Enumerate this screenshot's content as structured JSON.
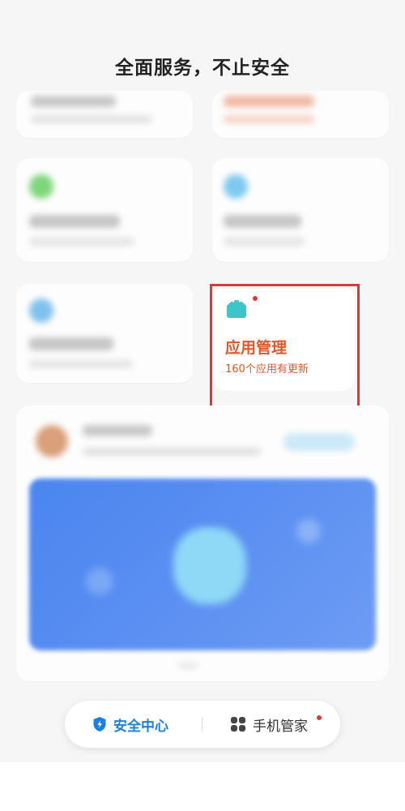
{
  "headline": "全面服务，不止安全",
  "app_card": {
    "title": "应用管理",
    "subtitle": "160个应用有更新",
    "icon": "android-icon",
    "has_badge": true
  },
  "bottom_nav": {
    "left": {
      "label": "安全中心",
      "icon": "shield-icon",
      "active": true
    },
    "right": {
      "label": "手机管家",
      "icon": "apps-grid-icon",
      "has_badge": true
    }
  },
  "colors": {
    "accent_orange": "#e0582a",
    "active_blue": "#1d7fe0",
    "highlight_red": "#d63b3b",
    "badge_red": "#e8343c"
  }
}
